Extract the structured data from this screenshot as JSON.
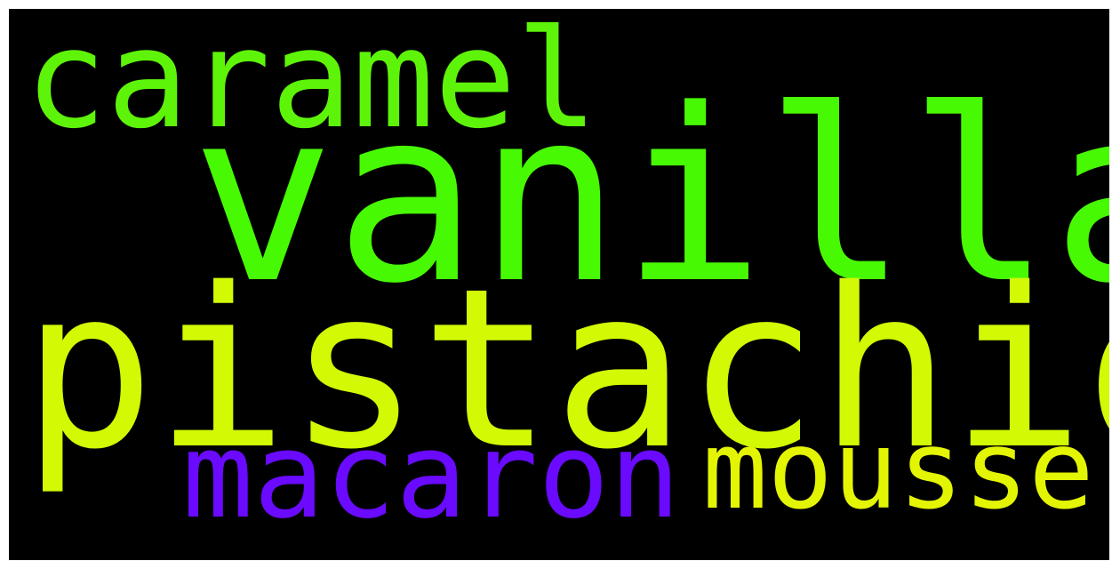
{
  "words": [
    {
      "id": "vanilla",
      "text": "vanilla",
      "color": "#48f904"
    },
    {
      "id": "pistachio",
      "text": "pistachio",
      "color": "#d3f904"
    },
    {
      "id": "caramel",
      "text": "caramel",
      "color": "#5ef40a"
    },
    {
      "id": "macaron",
      "text": "macaron",
      "color": "#6a0aff"
    },
    {
      "id": "mousse",
      "text": "mousse",
      "color": "#e4f504"
    }
  ],
  "background": "#000000"
}
